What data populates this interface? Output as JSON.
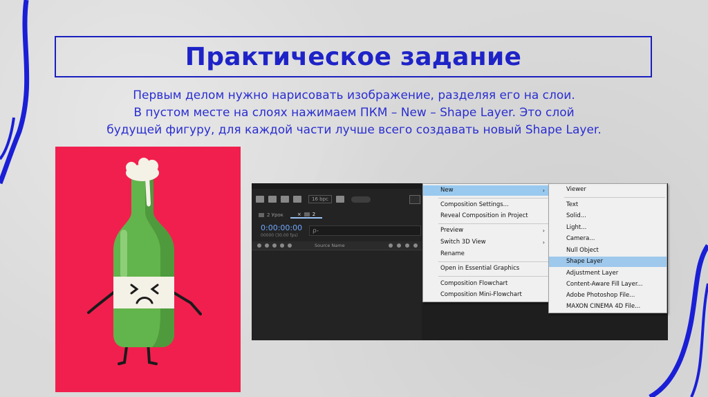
{
  "slide": {
    "title": "Практическое задание",
    "intro_lines": [
      "Первым делом нужно нарисовать изображение, разделяя его на слои.",
      "В пустом месте на слоях нажимаем ПКМ – New – Shape Layer. Это слой",
      "будущей фигуру, для каждой части лучше всего создавать новый Shape Layer."
    ],
    "accent_color": "#1e23c7",
    "illustration_bg": "#f11f4e"
  },
  "after_effects": {
    "bpc": "16 bpc",
    "tabs": [
      "2 Урок",
      "2"
    ],
    "timecode": "0:00:00:00",
    "fps": "00000 (30.00 fps)",
    "search_placeholder": "ρ-",
    "column_source_name": "Source Name"
  },
  "context_menu": {
    "items": [
      {
        "label": "New",
        "submenu": true
      },
      {
        "label": "Composition Settings..."
      },
      {
        "label": "Reveal Composition in Project"
      },
      {
        "label": "Preview",
        "submenu": true
      },
      {
        "label": "Switch 3D View",
        "submenu": true
      },
      {
        "label": "Rename"
      },
      {
        "label": "Open in Essential Graphics"
      },
      {
        "label": "Composition Flowchart"
      },
      {
        "label": "Composition Mini-Flowchart"
      }
    ],
    "highlighted": "New"
  },
  "new_submenu": {
    "items": [
      "Viewer",
      "Text",
      "Solid...",
      "Light...",
      "Camera...",
      "Null Object",
      "Shape Layer",
      "Adjustment Layer",
      "Content-Aware Fill Layer...",
      "Adobe Photoshop File...",
      "MAXON CINEMA 4D File..."
    ],
    "highlighted": "Shape Layer"
  }
}
